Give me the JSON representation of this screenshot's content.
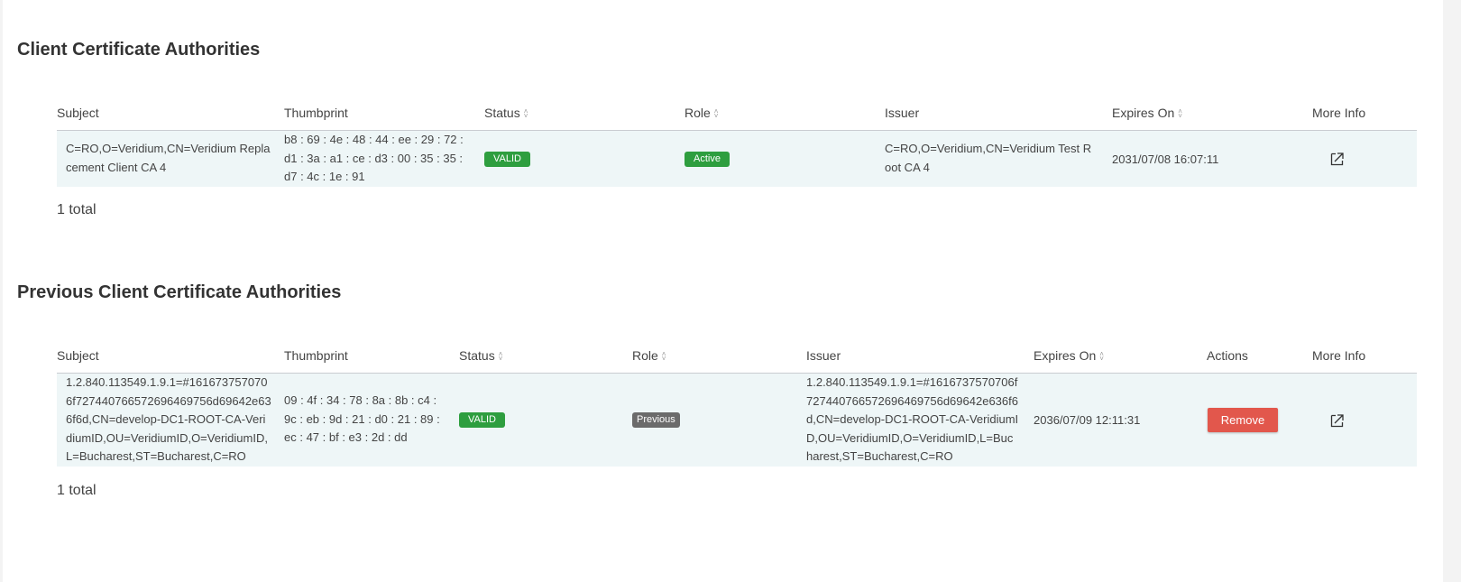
{
  "sections": {
    "current": {
      "title": "Client Certificate Authorities",
      "headers": {
        "subject": "Subject",
        "thumbprint": "Thumbprint",
        "status": "Status",
        "role": "Role",
        "issuer": "Issuer",
        "expires": "Expires On",
        "more": "More Info"
      },
      "row": {
        "subject": "C=RO,O=Veridium,CN=Veridium Replacement Client CA 4",
        "thumbprint": "b8 : 69 : 4e : 48 : 44 : ee : 29 : 72 : d1 : 3a : a1 : ce : d3 : 00 : 35 : 35 : d7 : 4c : 1e : 91",
        "status": "VALID",
        "role": "Active",
        "issuer": "C=RO,O=Veridium,CN=Veridium Test Root CA 4",
        "expires": "2031/07/08 16:07:11"
      },
      "total": "1 total"
    },
    "previous": {
      "title": "Previous Client Certificate Authorities",
      "headers": {
        "subject": "Subject",
        "thumbprint": "Thumbprint",
        "status": "Status",
        "role": "Role",
        "issuer": "Issuer",
        "expires": "Expires On",
        "actions": "Actions",
        "more": "More Info"
      },
      "row": {
        "subject": "1.2.840.113549.1.9.1=#1616737570706f727440766572696469756d69642e636f6d,CN=develop-DC1-ROOT-CA-VeridiumID,OU=VeridiumID,O=VeridiumID,L=Bucharest,ST=Bucharest,C=RO",
        "thumbprint": "09 : 4f : 34 : 78 : 8a : 8b : c4 : 9c : eb : 9d : 21 : d0 : 21 : 89 : ec : 47 : bf : e3 : 2d : dd",
        "status": "VALID",
        "role": "Previous",
        "issuer": "1.2.840.113549.1.9.1=#1616737570706f727440766572696469756d69642e636f6d,CN=develop-DC1-ROOT-CA-VeridiumID,OU=VeridiumID,O=VeridiumID,L=Bucharest,ST=Bucharest,C=RO",
        "expires": "2036/07/09 12:11:31",
        "action": "Remove"
      },
      "total": "1 total"
    }
  },
  "icons": {
    "sort": "sort-icon",
    "more_info": "external-link-icon"
  },
  "colors": {
    "valid": "#2e9e3f",
    "active": "#2e9e3f",
    "previous": "#6b6b6b",
    "remove": "#e2574c",
    "row_bg": "#eef6f7"
  }
}
